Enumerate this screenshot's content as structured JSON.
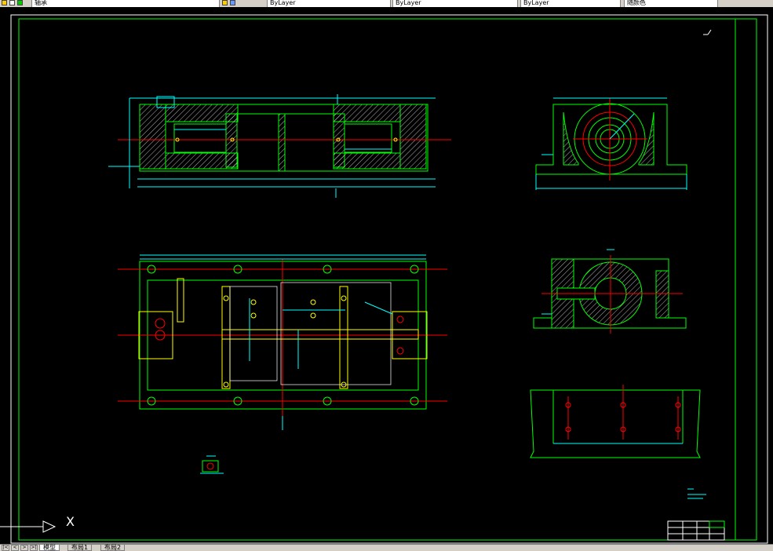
{
  "toolbar": {
    "layer_name": "轴承",
    "linetype_1": "ByLayer",
    "linetype_2": "ByLayer",
    "lineweight": "ByLayer",
    "plot_style": "随颜色"
  },
  "tabs": [
    {
      "label": "模型"
    },
    {
      "label": "布局1"
    },
    {
      "label": "布局2"
    }
  ],
  "ucs": {
    "x_label": "X"
  },
  "colors": {
    "background": "#000000",
    "outline": "#00ff00",
    "dimension": "#00ffff",
    "centerline": "#ff0000",
    "hatch": "#ffffff",
    "hidden": "#ffff00"
  }
}
